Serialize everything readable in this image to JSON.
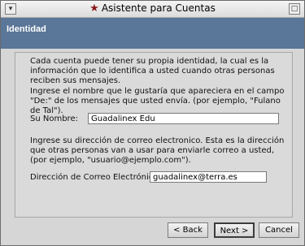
{
  "window": {
    "title": "Asistente para Cuentas",
    "title_icon": "star-icon"
  },
  "header": {
    "title": "Identidad"
  },
  "intro": {
    "text": "Cada cuenta puede tener su propia identidad, la cual es la información que lo identifica a usted cuando otras personas reciben sus mensajes."
  },
  "name_section": {
    "instructions": "Ingrese el nombre que le gustaría que apareciera en el campo \"De:\" de los mensajes que usted envía. (por ejemplo, \"Fulano de Tal\").",
    "label": "Su Nombre:",
    "value": "Guadalinex Edu"
  },
  "email_section": {
    "instructions": "Ingrese su dirección de correo electronico. Esta es la dirección que otras personas van a usar para enviarle correo a usted, (por ejemplo, \"usuario@ejemplo.com\").",
    "label": "Dirección de Correo Electrónico:",
    "value": "guadalinex@terra.es"
  },
  "buttons": {
    "back": "< Back",
    "next": "Next >",
    "cancel": "Cancel"
  },
  "colors": {
    "header_bg": "#5a7698",
    "window_bg": "#d6d6d6"
  }
}
